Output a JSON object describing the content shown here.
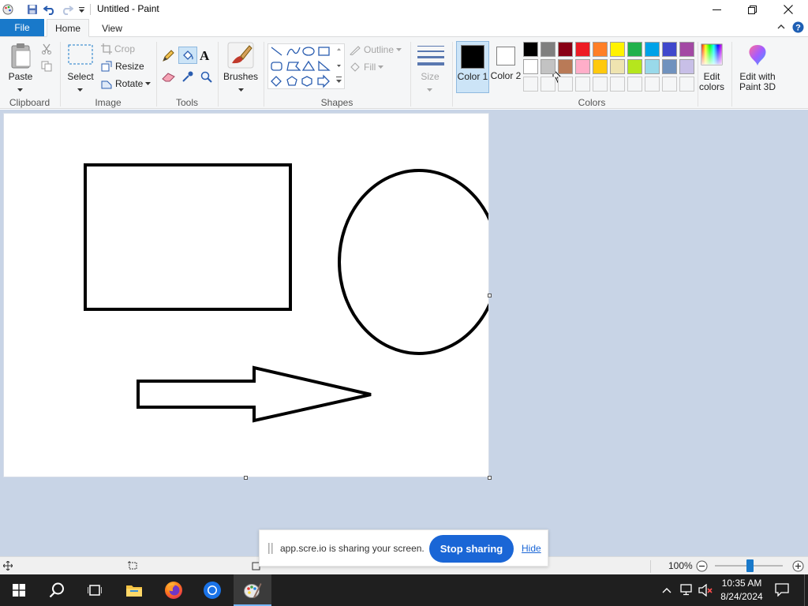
{
  "window": {
    "title": "Untitled - Paint"
  },
  "tabs": [
    {
      "label": "File"
    },
    {
      "label": "Home"
    },
    {
      "label": "View"
    }
  ],
  "ribbon": {
    "clipboard": {
      "group": "Clipboard",
      "paste": "Paste"
    },
    "image": {
      "group": "Image",
      "select": "Select",
      "crop": "Crop",
      "resize": "Resize",
      "rotate": "Rotate"
    },
    "tools": {
      "group": "Tools"
    },
    "brushes": {
      "label": "Brushes"
    },
    "shapes": {
      "group": "Shapes",
      "outline": "Outline",
      "fill": "Fill"
    },
    "size": {
      "label": "Size"
    },
    "colors": {
      "group": "Colors",
      "color1": "Color 1",
      "color2": "Color 2",
      "edit_colors": "Edit colors",
      "paint3d": "Edit with Paint 3D",
      "color1_value": "#000000",
      "color2_value": "#ffffff",
      "row1": [
        "#000000",
        "#7f7f7f",
        "#880015",
        "#ed1c24",
        "#ff7f27",
        "#fff200",
        "#22b14c",
        "#00a2e8",
        "#3f48cc",
        "#a349a4"
      ],
      "row2": [
        "#ffffff",
        "#c3c3c3",
        "#b97a57",
        "#ffaec9",
        "#ffc90e",
        "#efe4b0",
        "#b5e61d",
        "#99d9ea",
        "#7092be",
        "#c8bfe7"
      ]
    }
  },
  "status": {
    "zoom": "100%"
  },
  "share_banner": {
    "message": "app.scre.io is sharing your screen.",
    "stop": "Stop sharing",
    "hide": "Hide"
  },
  "taskbar": {
    "time": "10:35 AM",
    "date": "8/24/2024"
  }
}
